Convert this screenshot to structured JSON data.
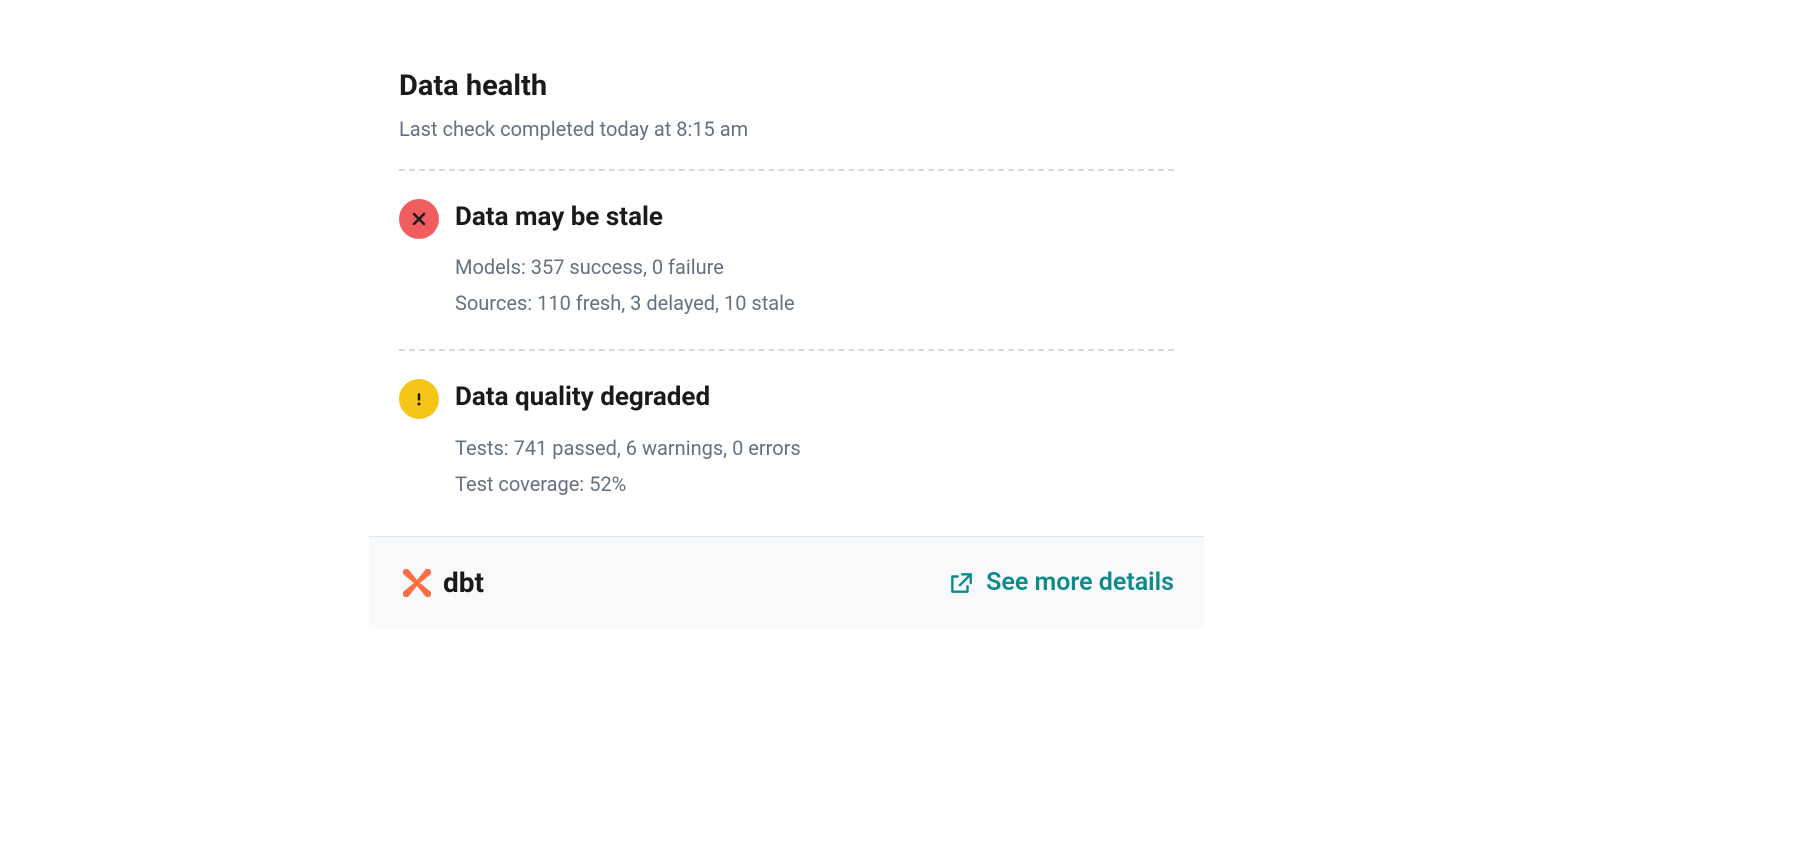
{
  "header": {
    "title": "Data health",
    "subtitle": "Last check completed today at 8:15 am"
  },
  "sections": [
    {
      "status": "error",
      "title": "Data may be stale",
      "details": [
        "Models: 357 success, 0 failure",
        "Sources: 110 fresh, 3 delayed, 10 stale"
      ]
    },
    {
      "status": "warning",
      "title": "Data quality degraded",
      "details": [
        "Tests: 741 passed, 6 warnings, 0 errors",
        "Test coverage: 52%"
      ]
    }
  ],
  "footer": {
    "brand": "dbt",
    "link_label": "See more details"
  },
  "colors": {
    "error": "#ef5d60",
    "warning": "#f5c517",
    "link": "#0d8b8b",
    "brand_orange": "#ff6e42"
  }
}
